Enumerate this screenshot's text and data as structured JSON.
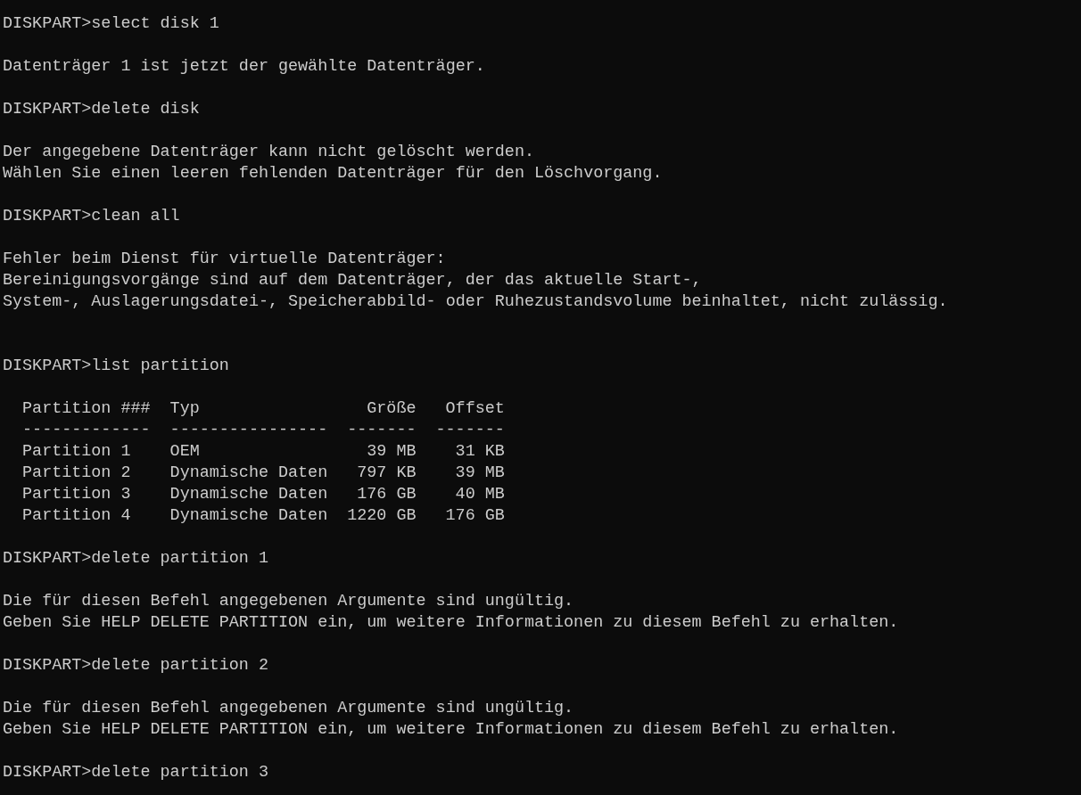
{
  "console": [
    {
      "kind": "prompt",
      "prompt": "DISKPART>",
      "command": "select disk 1"
    },
    {
      "kind": "blank"
    },
    {
      "kind": "output",
      "text": "Datenträger 1 ist jetzt der gewählte Datenträger."
    },
    {
      "kind": "blank"
    },
    {
      "kind": "prompt",
      "prompt": "DISKPART>",
      "command": "delete disk"
    },
    {
      "kind": "blank"
    },
    {
      "kind": "output",
      "text": "Der angegebene Datenträger kann nicht gelöscht werden."
    },
    {
      "kind": "output",
      "text": "Wählen Sie einen leeren fehlenden Datenträger für den Löschvorgang."
    },
    {
      "kind": "blank"
    },
    {
      "kind": "prompt",
      "prompt": "DISKPART>",
      "command": "clean all"
    },
    {
      "kind": "blank"
    },
    {
      "kind": "output",
      "text": "Fehler beim Dienst für virtuelle Datenträger:"
    },
    {
      "kind": "output",
      "text": "Bereinigungsvorgänge sind auf dem Datenträger, der das aktuelle Start-,"
    },
    {
      "kind": "output",
      "text": "System-, Auslagerungsdatei-, Speicherabbild- oder Ruhezustandsvolume beinhaltet, nicht zulässig."
    },
    {
      "kind": "blank"
    },
    {
      "kind": "blank"
    },
    {
      "kind": "prompt",
      "prompt": "DISKPART>",
      "command": "list partition"
    },
    {
      "kind": "blank"
    },
    {
      "kind": "table",
      "columns": [
        "Partition ###",
        "Typ",
        "Größe",
        "Offset"
      ],
      "rule": [
        "-------------",
        "----------------",
        "-------",
        "-------"
      ],
      "rows": [
        [
          "Partition 1",
          "OEM",
          "39 MB",
          "31 KB"
        ],
        [
          "Partition 2",
          "Dynamische Daten",
          "797 KB",
          "39 MB"
        ],
        [
          "Partition 3",
          "Dynamische Daten",
          "176 GB",
          "40 MB"
        ],
        [
          "Partition 4",
          "Dynamische Daten",
          "1220 GB",
          "176 GB"
        ]
      ]
    },
    {
      "kind": "blank"
    },
    {
      "kind": "prompt",
      "prompt": "DISKPART>",
      "command": "delete partition 1"
    },
    {
      "kind": "blank"
    },
    {
      "kind": "output",
      "text": "Die für diesen Befehl angegebenen Argumente sind ungültig."
    },
    {
      "kind": "output",
      "text": "Geben Sie HELP DELETE PARTITION ein, um weitere Informationen zu diesem Befehl zu erhalten."
    },
    {
      "kind": "blank"
    },
    {
      "kind": "prompt",
      "prompt": "DISKPART>",
      "command": "delete partition 2"
    },
    {
      "kind": "blank"
    },
    {
      "kind": "output",
      "text": "Die für diesen Befehl angegebenen Argumente sind ungültig."
    },
    {
      "kind": "output",
      "text": "Geben Sie HELP DELETE PARTITION ein, um weitere Informationen zu diesem Befehl zu erhalten."
    },
    {
      "kind": "blank"
    },
    {
      "kind": "prompt",
      "prompt": "DISKPART>",
      "command": "delete partition 3"
    }
  ]
}
